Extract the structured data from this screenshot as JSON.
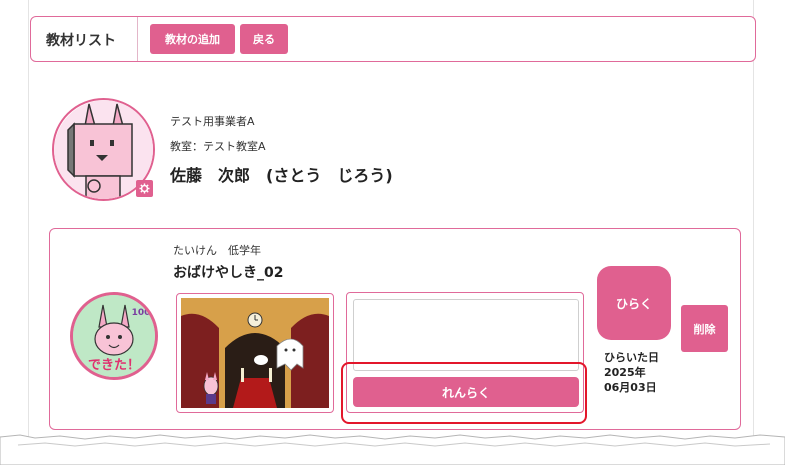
{
  "header": {
    "title": "教材リスト",
    "add_button": "教材の追加",
    "back_button": "戻る"
  },
  "profile": {
    "company": "テスト用事業者A",
    "classroom": "教室：テスト教室A",
    "name": "佐藤　次郎　(さとう　じろう)"
  },
  "course": {
    "category": "たいけん　低学年",
    "title": "おばけやしき_02",
    "contact_button": "れんらく",
    "open_button": "ひらく",
    "opened_label": "ひらいた日",
    "opened_year": "2025年",
    "opened_month_day": "06月03日",
    "delete_button": "削除",
    "done_badge_text": "できた！",
    "done_badge_score": "100",
    "message_value": ""
  },
  "colors": {
    "accent": "#e0608f",
    "highlight": "#e3162b"
  },
  "icons": {
    "gear": "gear-icon"
  }
}
